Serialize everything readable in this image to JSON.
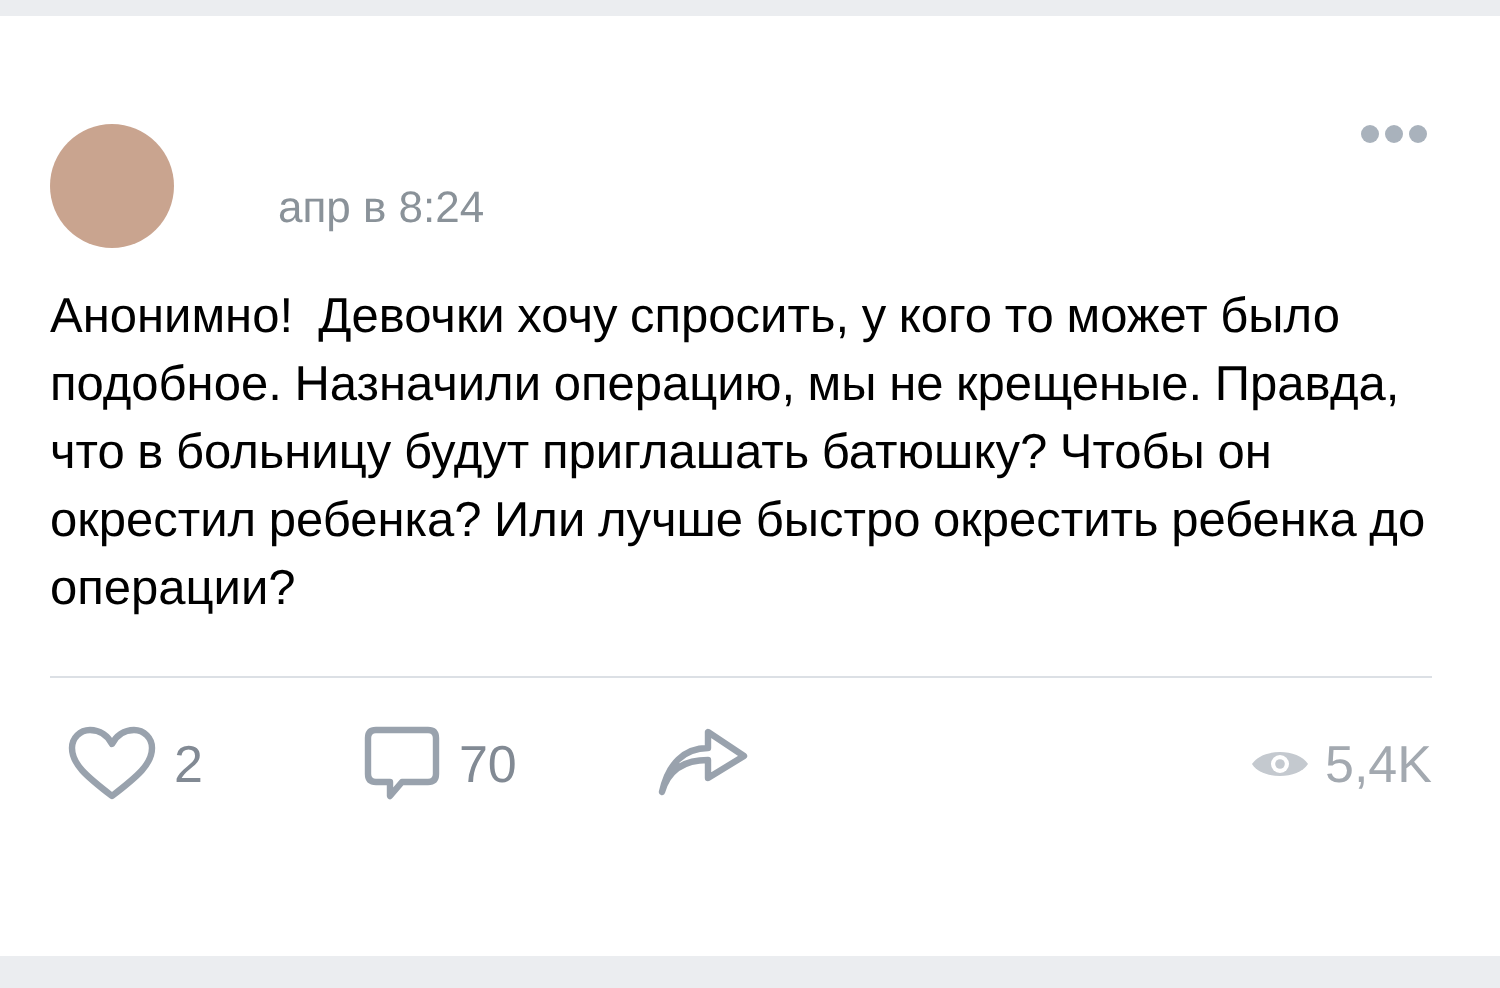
{
  "post": {
    "date": "апр в 8:24",
    "text": "Анонимно!  Девочки хочу спросить, у кого то может было подобное. Назначили операцию, мы не крещеные. Правда, что в больницу будут приглашать батюшку? Чтобы он  окрестил ребенка? Или лучше быстро окрестить ребенка до операции?"
  },
  "actions": {
    "likes": "2",
    "liked": false,
    "comments": "70",
    "views": "5,4K"
  }
}
